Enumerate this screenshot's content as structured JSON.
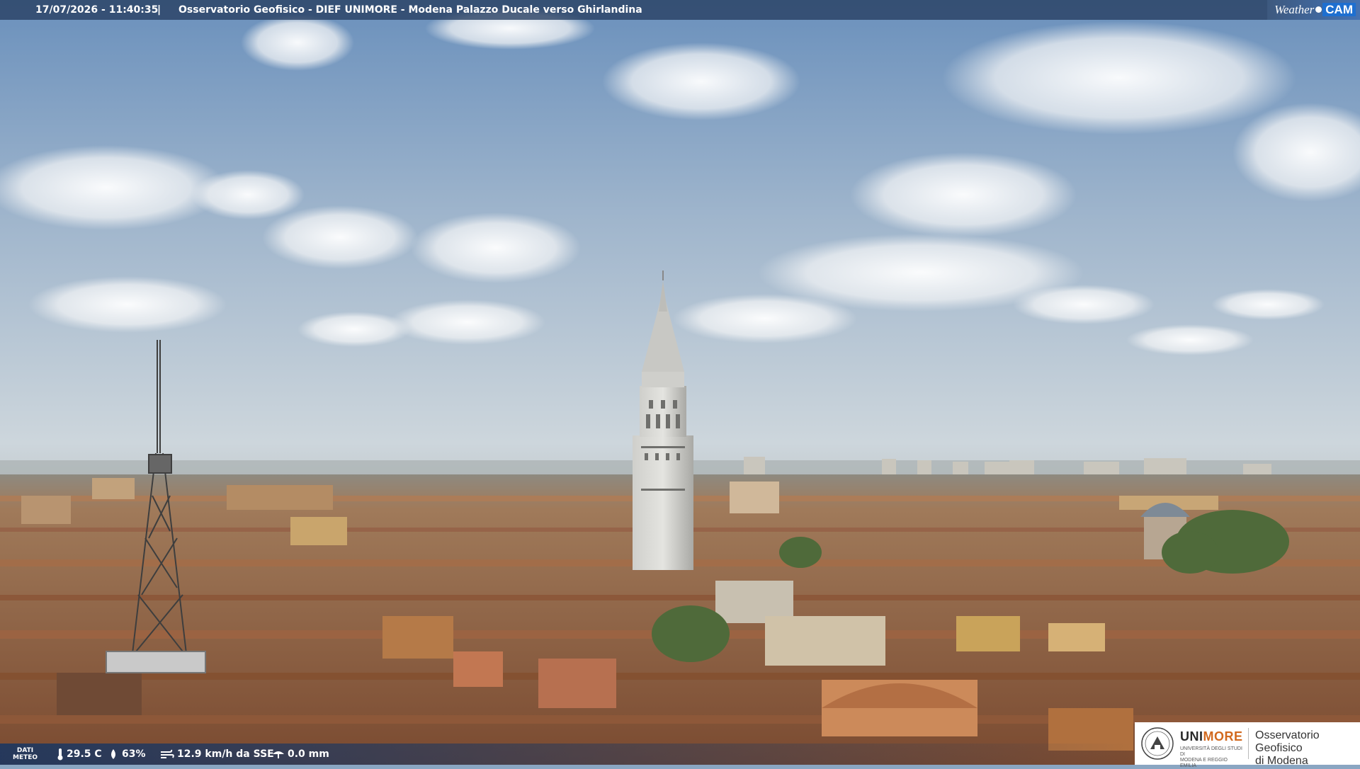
{
  "overlay_top": {
    "timestamp": "17/07/2026 - 11:40:35",
    "separator": "|",
    "title": "Osservatorio Geofisico - DIEF UNIMORE - Modena Palazzo Ducale verso Ghirlandina"
  },
  "brand": {
    "weather": "Weather",
    "cam": "CAM"
  },
  "weather": {
    "label_line1": "DATI",
    "label_line2": "METEO",
    "temperature": "29.5 C",
    "humidity": "63%",
    "wind": "12.9 km/h da SSE",
    "rain": "0.0 mm",
    "icons": [
      "thermometer-icon",
      "humidity-drop-icon",
      "wind-icon",
      "rain-icon"
    ]
  },
  "logo": {
    "uni": "UNI",
    "more": "MORE",
    "subtitle_line1": "UNIVERSITÀ DEGLI STUDI DI",
    "subtitle_line2": "MODENA E REGGIO EMILIA",
    "obs_line1": "Osservatorio Geofisico",
    "obs_line2": "di Modena"
  },
  "colors": {
    "sky_top": "#6f93bd",
    "sky_horizon": "#c9d4dc",
    "roof": "#a0643e",
    "tower": "#d8d8d4",
    "overlay": "#263e60",
    "logo_accent": "#d2691e"
  }
}
